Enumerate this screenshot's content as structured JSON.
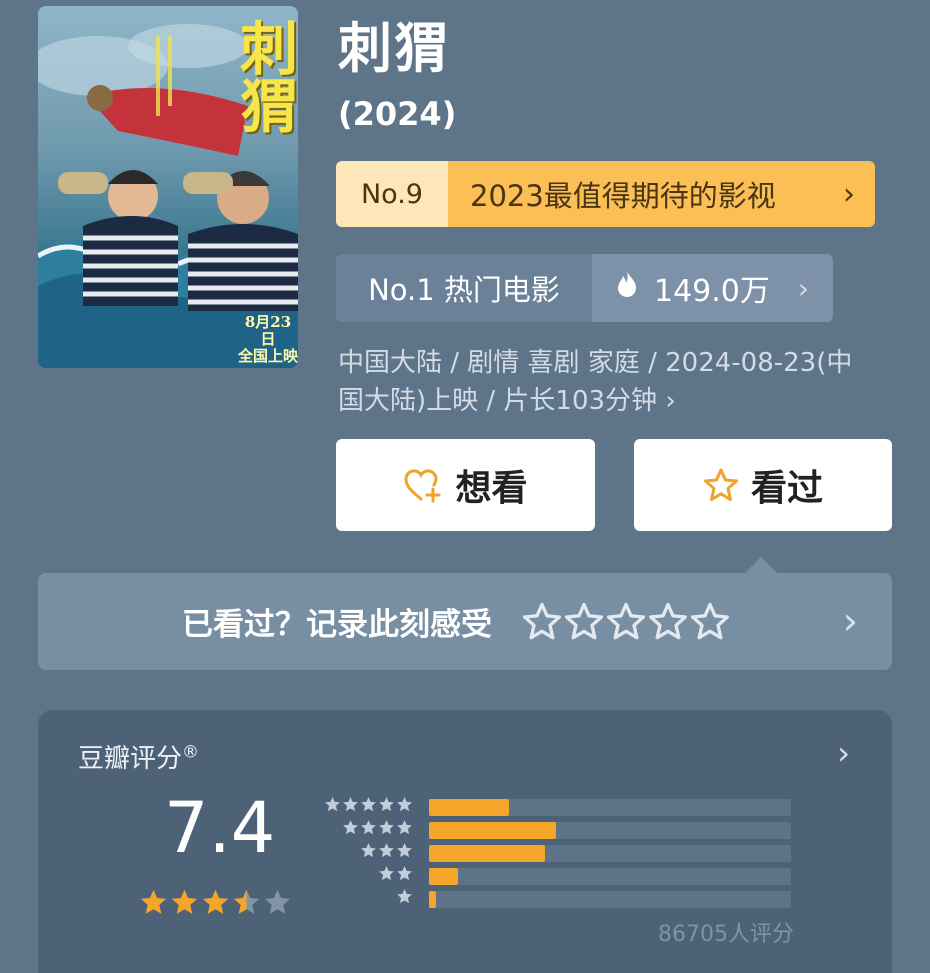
{
  "movie": {
    "title": "刺猬",
    "year": "(2024)",
    "poster": {
      "title": "刺猬",
      "release_line1": "8月23日",
      "release_line2": "全国上映"
    }
  },
  "rank_banner": {
    "number": "No.9",
    "text": "2023最值得期待的影视",
    "arrow": "›"
  },
  "hot": {
    "label": "No.1 热门电影",
    "icon": "fire-icon",
    "value": "149.0万",
    "arrow": "›"
  },
  "info": {
    "text": "中国大陆 / 剧情 喜剧 家庭 / 2024-08-23(中国大陆)上映 / 片长103分钟",
    "arrow": "›"
  },
  "buttons": {
    "want": {
      "label": "想看",
      "icon": "heart-plus-icon"
    },
    "seen": {
      "label": "看过",
      "icon": "star-outline-icon"
    }
  },
  "record": {
    "text": "已看过？记录此刻感受",
    "star_count": 5,
    "arrow": "›"
  },
  "rating": {
    "title": "豆瓣评分",
    "trademark": "®",
    "arrow": "›",
    "score": "7.4",
    "stars_filled": 3.5,
    "distribution": [
      {
        "stars": 5,
        "fraction": 0.22
      },
      {
        "stars": 4,
        "fraction": 0.35
      },
      {
        "stars": 3,
        "fraction": 0.32
      },
      {
        "stars": 2,
        "fraction": 0.08
      },
      {
        "stars": 1,
        "fraction": 0.02
      }
    ],
    "count_text": "86705人评分"
  },
  "colors": {
    "background": "#5e7489",
    "accent_orange": "#fbbf55",
    "star_orange": "#f4a62a",
    "panel": "#788ea3",
    "rating_card": "#4e6277"
  }
}
